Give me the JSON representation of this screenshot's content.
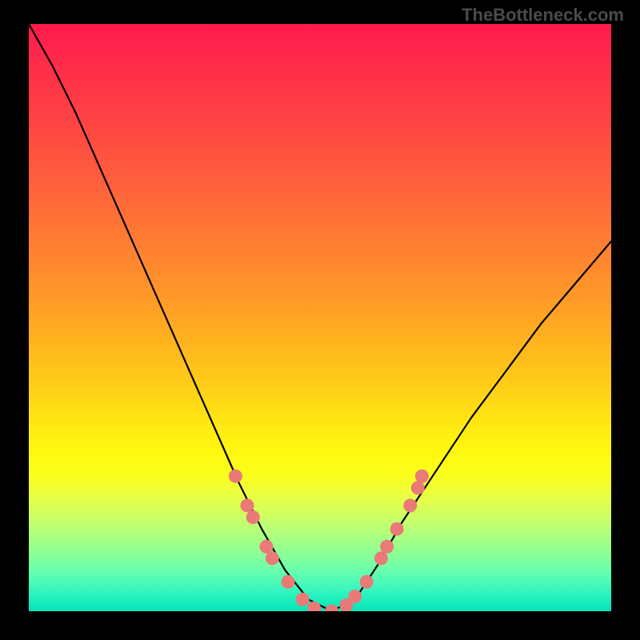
{
  "watermark": "TheBottleneck.com",
  "chart_data": {
    "type": "line",
    "title": "",
    "xlabel": "",
    "ylabel": "",
    "xlim": [
      0,
      1
    ],
    "ylim": [
      0,
      100
    ],
    "axes_visible": false,
    "series": [
      {
        "name": "curve",
        "x": [
          0.0,
          0.04,
          0.08,
          0.12,
          0.16,
          0.2,
          0.24,
          0.28,
          0.32,
          0.36,
          0.4,
          0.44,
          0.48,
          0.52,
          0.56,
          0.6,
          0.64,
          0.7,
          0.76,
          0.82,
          0.88,
          0.94,
          1.0
        ],
        "y": [
          100,
          93,
          85,
          76,
          67,
          58,
          49,
          40,
          31,
          22,
          14,
          7,
          2,
          0,
          2,
          8,
          15,
          24,
          33,
          41,
          49,
          56,
          63
        ]
      }
    ],
    "markers": [
      {
        "x": 0.355,
        "y": 23
      },
      {
        "x": 0.375,
        "y": 18
      },
      {
        "x": 0.385,
        "y": 16
      },
      {
        "x": 0.408,
        "y": 11
      },
      {
        "x": 0.418,
        "y": 9
      },
      {
        "x": 0.445,
        "y": 5
      },
      {
        "x": 0.47,
        "y": 2
      },
      {
        "x": 0.49,
        "y": 0.5
      },
      {
        "x": 0.52,
        "y": 0
      },
      {
        "x": 0.545,
        "y": 1
      },
      {
        "x": 0.56,
        "y": 2.5
      },
      {
        "x": 0.58,
        "y": 5
      },
      {
        "x": 0.605,
        "y": 9
      },
      {
        "x": 0.615,
        "y": 11
      },
      {
        "x": 0.632,
        "y": 14
      },
      {
        "x": 0.655,
        "y": 18
      },
      {
        "x": 0.668,
        "y": 21
      },
      {
        "x": 0.675,
        "y": 23
      }
    ],
    "colors": {
      "curve": "#000000",
      "marker_fill": "#e97a78",
      "marker_stroke": "#c95a58"
    }
  }
}
